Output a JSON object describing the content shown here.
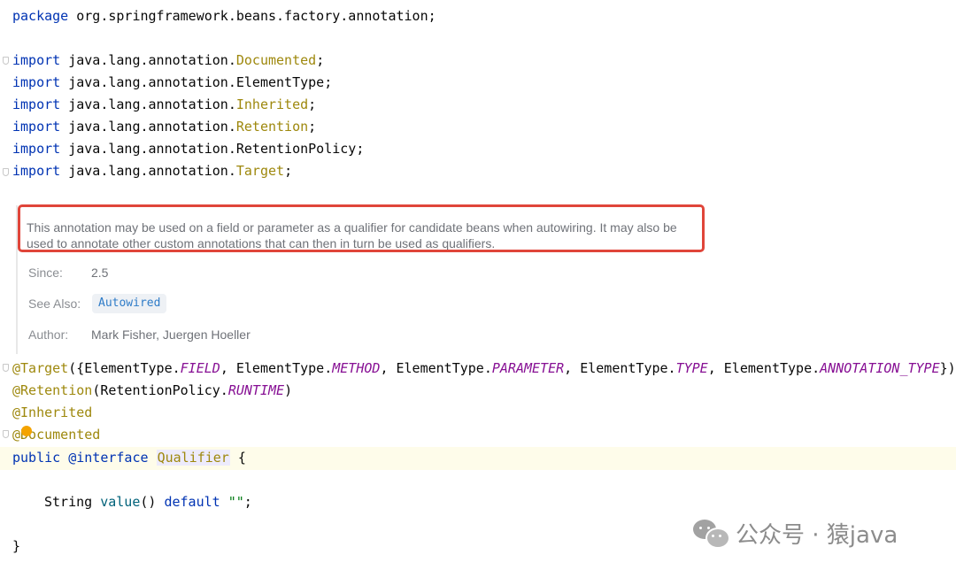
{
  "code": {
    "package_kw": "package",
    "package_name": " org.springframework.beans.factory.annotation;",
    "import_kw": "import",
    "import_prefix": " java.lang.annotation.",
    "imports": [
      {
        "cls": "Documented",
        "used": true
      },
      {
        "cls": "ElementType",
        "used": false
      },
      {
        "cls": "Inherited",
        "used": true
      },
      {
        "cls": "Retention",
        "used": true
      },
      {
        "cls": "RetentionPolicy",
        "used": false
      },
      {
        "cls": "Target",
        "used": true
      }
    ],
    "semicolon": ";",
    "target_ann": "@Target",
    "target_args_open": "({",
    "element_type": "ElementType.",
    "target_fields": [
      "FIELD",
      "METHOD",
      "PARAMETER",
      "TYPE",
      "ANNOTATION_TYPE"
    ],
    "comma": ", ",
    "target_args_close": "})",
    "retention_ann": "@Retention",
    "retention_open": "(RetentionPolicy.",
    "retention_value": "RUNTIME",
    "retention_close": ")",
    "inherited_ann": "@Inherited",
    "documented_ann": "@Documented",
    "public_kw": "public",
    "interface_kw": "@interface",
    "class_name": "Qualifier",
    "open_brace": " {",
    "method_type": "String",
    "method_name": "value",
    "method_parens": "()",
    "default_kw": "default",
    "default_value": "\"\"",
    "close_brace": "}"
  },
  "doc": {
    "description": "This annotation may be used on a field or parameter as a qualifier for candidate beans when autowiring. It may also be used to annotate other custom annotations that can then in turn be used as qualifiers.",
    "since_label": "Since:",
    "since_value": "2.5",
    "see_also_label": "See Also:",
    "see_also_link": "Autowired",
    "author_label": "Author:",
    "author_value": "Mark Fisher, Juergen Hoeller"
  },
  "watermark": {
    "text": "公众号 · 猿java"
  },
  "colors": {
    "keyword": "#0033b3",
    "annotation": "#9e880d",
    "field": "#871094",
    "highlight_box": "#e0453a"
  }
}
